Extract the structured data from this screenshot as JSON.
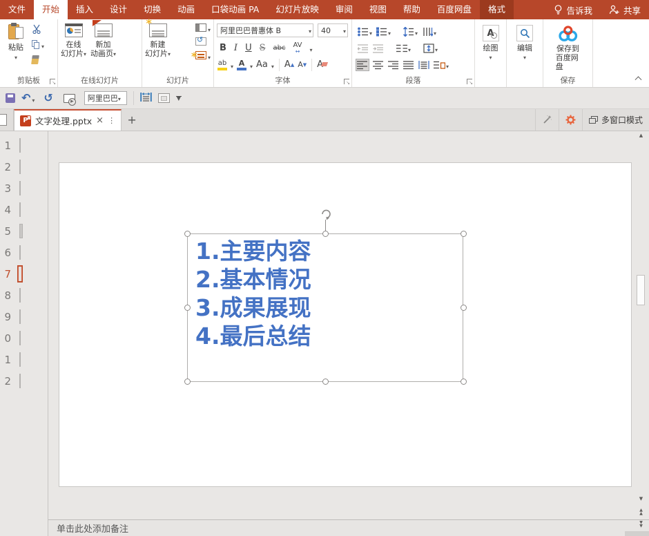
{
  "colors": {
    "accent": "#B7472A",
    "contextual_tab": "#9C3A1E",
    "selection_orange": "#C0502F",
    "text_blue": "#4472C4"
  },
  "tabbar": {
    "items": [
      "文件",
      "开始",
      "插入",
      "设计",
      "切换",
      "动画",
      "口袋动画 PA",
      "幻灯片放映",
      "审阅",
      "视图",
      "帮助",
      "百度网盘",
      "格式"
    ],
    "tell_me": "告诉我",
    "share": "共享"
  },
  "ribbon": {
    "clipboard": {
      "group_label": "剪贴板",
      "paste": "粘贴"
    },
    "online": {
      "group_label": "在线幻灯片",
      "b1l1": "在线",
      "b1l2": "幻灯片",
      "b2l1": "新加",
      "b2l2": "动画页"
    },
    "slides": {
      "group_label": "幻灯片",
      "l1": "新建",
      "l2": "幻灯片"
    },
    "font": {
      "group_label": "字体",
      "name": "阿里巴巴普惠体 B",
      "size": "40",
      "bold": "B",
      "italic": "I",
      "underline": "U",
      "strike": "S",
      "abc": "abc",
      "av": "AV",
      "av_arrow": "↔",
      "highlight": "ab",
      "color": "A",
      "case": "Aa",
      "grow": "A",
      "grow_mark": "▲",
      "shrink": "A",
      "shrink_mark": "▼",
      "clear": "A"
    },
    "paragraph": {
      "group_label": "段落"
    },
    "drawing": {
      "label": "绘图"
    },
    "editing": {
      "label": "编辑"
    },
    "save": {
      "group_label": "保存",
      "l1": "保存到",
      "l2": "百度网盘"
    }
  },
  "qat": {
    "font": "阿里巴巴"
  },
  "doctabs": {
    "title": "文字处理.pptx",
    "close": "×",
    "menu": "⋮",
    "new_tab": "+",
    "multiwindow": "多窗口模式"
  },
  "slide_panel": {
    "items": [
      {
        "num": "1",
        "thumb_style": "background:#161616",
        "mark_style": "width:10px;height:3px;background:#C23B2A;margin:6px auto 0"
      },
      {
        "num": "2",
        "thumb_style": "background:#FFFFFF",
        "mark_style": "width:3px;height:3px;background:#B9B7B5;margin:6px auto 0"
      },
      {
        "num": "3",
        "thumb_style": "background:#161616",
        "mark_style": "width:12px;height:4px;background:#C23B2A;margin:6px auto 0;box-shadow:0 -3px 0 #7A7A7A"
      },
      {
        "num": "4",
        "thumb_style": "background:#161616",
        "mark_style": "width:14px;height:3px;background:#C23B2A;margin:5px auto 0;box-shadow:0 4px 0 #DDDDDD"
      },
      {
        "num": "5",
        "thumb_style": "background:#C9C7C5",
        "mark_style": "width:8px;height:6px;background:#C23B2A;margin:5px 3px 0 auto"
      },
      {
        "num": "6",
        "thumb_style": "background:#D6D4D2",
        "mark_style": "width:6px;height:2px;background:#8A8886;margin:7px auto 0"
      },
      {
        "num": "7",
        "thumb_style": "background:#FFFFFF",
        "mark_style": "width:9px;height:5px;background:#4472C4;margin:5px auto 0"
      },
      {
        "num": "8",
        "thumb_style": "background:#161616",
        "mark_style": "width:7px;height:5px;background:#C23B2A;margin:5px auto 0"
      },
      {
        "num": "9",
        "thumb_style": "background:#FFFFFF",
        "mark_style": "width:12px;height:2px;background:#3A3A3A;margin:7px auto 0"
      },
      {
        "num": "0",
        "thumb_style": "background:#FFFFFF",
        "mark_style": ""
      },
      {
        "num": "1",
        "thumb_style": "background:#161616",
        "mark_style": "width:10px;height:4px;background:#C23B2A;margin:5px auto 0;box-shadow:2px 3px 0 #E8E8E8"
      },
      {
        "num": "2",
        "thumb_style": "background:#161616",
        "mark_style": "width:8px;height:2px;background:#EDEDED;margin:7px auto 0"
      }
    ]
  },
  "slide": {
    "lines": [
      "1.主要内容",
      "2.基本情况",
      "3.成果展现",
      "4.最后总结"
    ]
  },
  "notes": {
    "placeholder": "单击此处添加备注"
  }
}
